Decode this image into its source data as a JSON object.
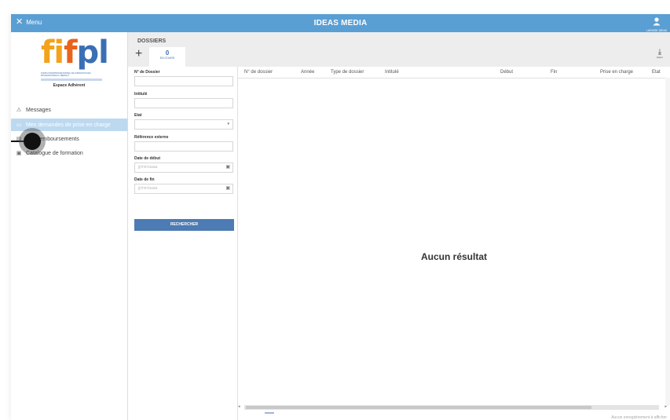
{
  "topbar": {
    "menu_label": "Menu",
    "title": "IDEAS MEDIA",
    "user_label": "LARISSE IDEAS"
  },
  "colors": {
    "topbar": "#5a9fd4",
    "accent": "#3b6fb5",
    "active_nav": "#bcd9f0",
    "search_button": "#4d7bb3"
  },
  "sidebar": {
    "logo": "fifpl",
    "logo_subtitle": "FONDS INTERPROFESSIONNEL DE FORMATION DES PROFESSIONNELS LIBERAUX",
    "espace": "Espace Adhérent",
    "items": [
      {
        "label": "Messages",
        "icon": "warning-triangle-icon"
      },
      {
        "label": "Mes demandes de prise en charge",
        "icon": "folder-icon"
      },
      {
        "label": "Mes remboursements",
        "icon": "card-icon"
      },
      {
        "label": "Catalogue de formation",
        "icon": "book-icon"
      }
    ]
  },
  "header": {
    "title": "DOSSIERS",
    "add_symbol": "+",
    "encours_count": "0",
    "encours_label": "EN COURS",
    "export_label": "Export"
  },
  "filters": {
    "dossier_label": "N° de Dossier",
    "intitule_label": "Intitulé",
    "etat_label": "Etat",
    "ref_label": "Référence externe",
    "date_debut_label": "Date de début",
    "date_debut_placeholder": "jj/mm/aaaa",
    "date_fin_label": "Date de fin",
    "date_fin_placeholder": "jj/mm/aaaa",
    "search_button": "RECHERCHER"
  },
  "table": {
    "columns": [
      "N° de dossier",
      "Année",
      "Type de dossier",
      "Intitulé",
      "Début",
      "Fin",
      "Prise en charge",
      "Etat"
    ],
    "empty_message": "Aucun résultat",
    "footer_note": "Aucun enregistrement à afficher"
  }
}
